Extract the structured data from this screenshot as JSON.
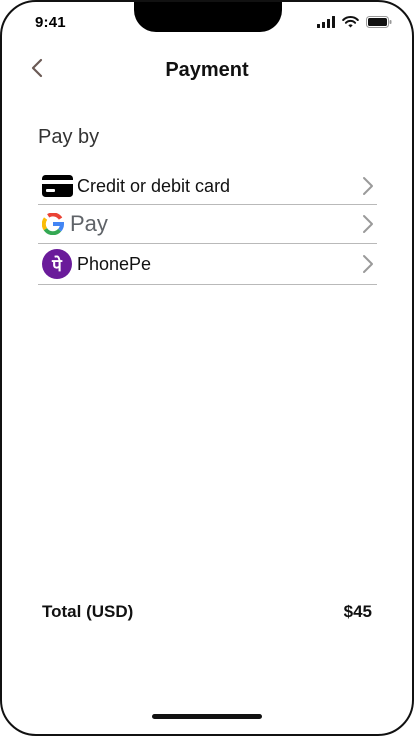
{
  "status_bar": {
    "time": "9:41",
    "icons": [
      "signal-icon",
      "wifi-icon",
      "battery-icon"
    ]
  },
  "header": {
    "title": "Payment",
    "back_icon": "chevron-left-icon"
  },
  "section": {
    "title": "Pay by"
  },
  "methods": [
    {
      "icon": "credit-card-icon",
      "label": "Credit or debit card"
    },
    {
      "icon": "google-g-icon",
      "label": "Pay"
    },
    {
      "icon": "phonepe-logo-icon",
      "label": "PhonePe",
      "logo_glyph": "पे"
    }
  ],
  "total": {
    "label": "Total (USD)",
    "amount": "$45"
  },
  "colors": {
    "phonepe_purple": "#6a1b9a",
    "chevron_gray": "#9a9a9a",
    "divider": "#b9b9b9",
    "back_chevron": "#6b5a55"
  }
}
